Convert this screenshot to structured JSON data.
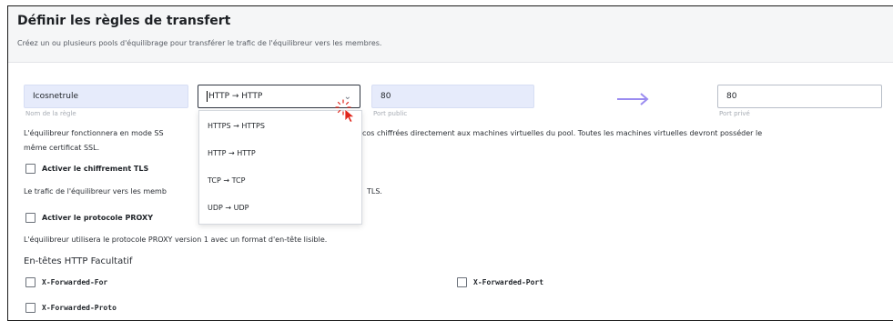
{
  "header": {
    "title": "Définir les règles de transfert",
    "subtitle": "Créez un ou plusieurs pools d'équilibrage pour transférer le trafic de l'équilibreur vers les membres."
  },
  "rule": {
    "name_value": "Icosnetrule",
    "name_hint": "Nom de la règle",
    "protocol_value": "HTTP → HTTP",
    "public_port_value": "80",
    "public_port_hint": "Port public",
    "private_port_value": "80",
    "private_port_hint": "Port privé"
  },
  "dropdown": {
    "options": [
      "HTTPS → HTTPS",
      "HTTP → HTTP",
      "TCP → TCP",
      "UDP → UDP"
    ]
  },
  "paragraphs": {
    "ssl_left": "L'équilibreur fonctionnera en mode SS",
    "ssl_right": "cos chiffrées directement aux machines virtuelles du pool. Toutes les machines virtuelles devront posséder le",
    "ssl_line2": "même certificat SSL.",
    "tls_left": "Le trafic de l'équilibreur vers les memb",
    "tls_right": "TLS.",
    "proxy_desc": "L'équilibreur utilisera le protocole PROXY version 1 avec un format d'en-tête lisible."
  },
  "options": {
    "tls_label": "Activer le chiffrement TLS",
    "proxy_label": "Activer le protocole PROXY"
  },
  "headers_section": {
    "title": "En-têtes HTTP Facultatif",
    "items": [
      "X-Forwarded-For",
      "X-Forwarded-Port",
      "X-Forwarded-Proto"
    ]
  },
  "colors": {
    "accent": "#9b8cf0",
    "field_fill": "#e6ebfb",
    "cursor": "#e0261c"
  }
}
